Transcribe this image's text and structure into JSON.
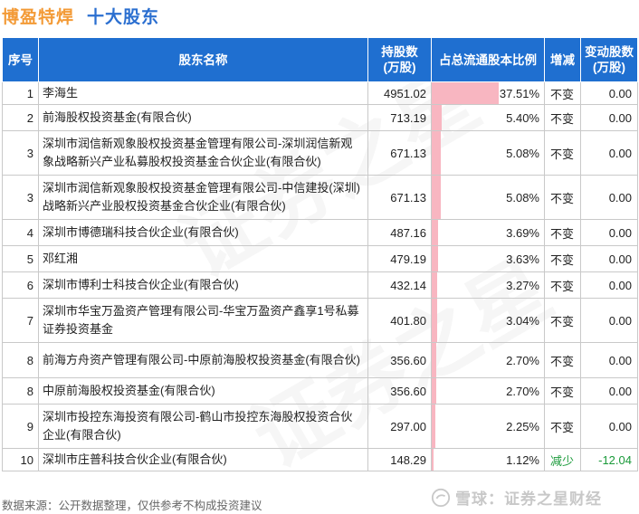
{
  "header": {
    "company": "博盈特焊",
    "section": "十大股东"
  },
  "columns": {
    "rank": "序号",
    "name": "股东名称",
    "shares_line1": "持股数",
    "shares_line2": "(万股)",
    "ratio": "占总流通股本比例",
    "trend": "增减",
    "change_line1": "变动股数",
    "change_line2": "(万股)"
  },
  "rows": [
    {
      "rank": "1",
      "name": "李海生",
      "shares": "4951.02",
      "ratio": "37.51%",
      "ratio_value": 37.51,
      "trend": "不变",
      "change": "0.00"
    },
    {
      "rank": "2",
      "name": "前海股权投资基金(有限合伙)",
      "shares": "713.19",
      "ratio": "5.40%",
      "ratio_value": 5.4,
      "trend": "不变",
      "change": "0.00"
    },
    {
      "rank": "3",
      "name": "深圳市润信新观象股权投资基金管理有限公司-深圳润信新观象战略新兴产业私募股权投资基金合伙企业(有限合伙)",
      "shares": "671.13",
      "ratio": "5.08%",
      "ratio_value": 5.08,
      "trend": "不变",
      "change": "0.00"
    },
    {
      "rank": "3",
      "name": "深圳市润信新观象股权投资基金管理有限公司-中信建投(深圳)战略新兴产业股权投资基金合伙企业(有限合伙)",
      "shares": "671.13",
      "ratio": "5.08%",
      "ratio_value": 5.08,
      "trend": "不变",
      "change": "0.00"
    },
    {
      "rank": "4",
      "name": "深圳市博德瑞科技合伙企业(有限合伙)",
      "shares": "487.16",
      "ratio": "3.69%",
      "ratio_value": 3.69,
      "trend": "不变",
      "change": "0.00"
    },
    {
      "rank": "5",
      "name": "邓红湘",
      "shares": "479.19",
      "ratio": "3.63%",
      "ratio_value": 3.63,
      "trend": "不变",
      "change": "0.00"
    },
    {
      "rank": "6",
      "name": "深圳市博利士科技合伙企业(有限合伙)",
      "shares": "432.14",
      "ratio": "3.27%",
      "ratio_value": 3.27,
      "trend": "不变",
      "change": "0.00"
    },
    {
      "rank": "7",
      "name": "深圳市华宝万盈资产管理有限公司-华宝万盈资产鑫享1号私募证券投资基金",
      "shares": "401.80",
      "ratio": "3.04%",
      "ratio_value": 3.04,
      "trend": "不变",
      "change": "0.00"
    },
    {
      "rank": "8",
      "name": "前海方舟资产管理有限公司-中原前海股权投资基金(有限合伙)",
      "shares": "356.60",
      "ratio": "2.70%",
      "ratio_value": 2.7,
      "trend": "不变",
      "change": "0.00"
    },
    {
      "rank": "8",
      "name": "中原前海股权投资基金(有限合伙)",
      "shares": "356.60",
      "ratio": "2.70%",
      "ratio_value": 2.7,
      "trend": "不变",
      "change": "0.00"
    },
    {
      "rank": "9",
      "name": "深圳市投控东海投资有限公司-鹤山市投控东海股权投资合伙企业(有限合伙)",
      "shares": "297.00",
      "ratio": "2.25%",
      "ratio_value": 2.25,
      "trend": "不变",
      "change": "0.00"
    },
    {
      "rank": "10",
      "name": "深圳市庄普科技合伙企业(有限合伙)",
      "shares": "148.29",
      "ratio": "1.12%",
      "ratio_value": 1.12,
      "trend": "减少",
      "change": "-12.04"
    }
  ],
  "footer": {
    "source": "数据来源：公开数据整理，仅供参考不构成投资建议"
  },
  "watermark": {
    "logo_text": "雪球：证券之星财经",
    "big_text": "证券之星"
  },
  "colors": {
    "header_bg": "#1f6fd0",
    "company_title": "#f39a36",
    "section_title": "#2b6fd0",
    "ratio_bar": "#f8b6c1",
    "decrease": "#1a9a3a"
  }
}
